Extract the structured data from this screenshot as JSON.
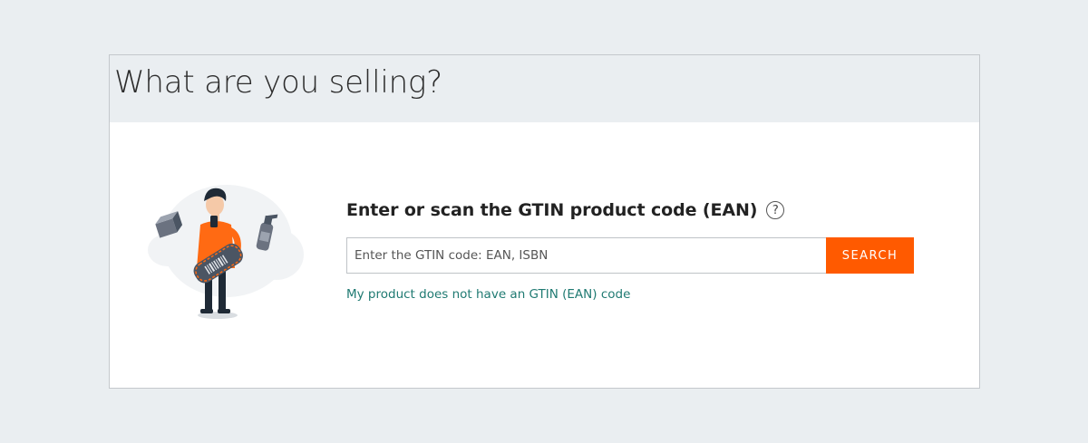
{
  "page": {
    "title": "What are you selling?"
  },
  "gtin": {
    "heading": "Enter or scan the GTIN product code (EAN)",
    "help_symbol": "?",
    "input_placeholder": "Enter the GTIN code: EAN, ISBN",
    "input_value": "",
    "search_label": "SEARCH",
    "no_code_link": "My product does not have an GTIN (EAN) code"
  },
  "colors": {
    "accent": "#ff5a00",
    "link": "#1f7a72",
    "header_bg": "#eaeef1"
  },
  "icons": {
    "illustration": "person-scanning-barcode-illustration",
    "help": "question-circle-icon"
  }
}
